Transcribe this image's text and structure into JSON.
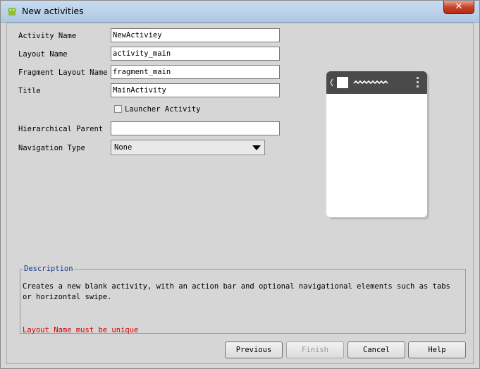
{
  "window": {
    "title": "New activities",
    "close_label": "✕"
  },
  "form": {
    "activity_name": {
      "label": "Activity Name",
      "value": "NewActiviey"
    },
    "layout_name": {
      "label": "Layout Name",
      "value": "activity_main"
    },
    "fragment_layout_name": {
      "label": "Fragment Layout Name",
      "value": "fragment_main"
    },
    "title": {
      "label": "Title",
      "value": "MainActivity"
    },
    "launcher_activity": {
      "label": "Launcher Activity",
      "checked": false
    },
    "hierarchical_parent": {
      "label": "Hierarchical Parent",
      "value": ""
    },
    "navigation_type": {
      "label": "Navigation Type",
      "selected": "None"
    }
  },
  "description": {
    "legend": "Description",
    "text": "Creates a new blank activity, with an action bar and optional navigational elements such as tabs or horizontal swipe.",
    "error": "Layout Name must be unique"
  },
  "buttons": {
    "previous": "Previous",
    "finish": "Finish",
    "cancel": "Cancel",
    "help": "Help"
  },
  "colors": {
    "error": "#d40000",
    "legend": "#1a3a8a",
    "device_bar": "#4a4a4a"
  }
}
